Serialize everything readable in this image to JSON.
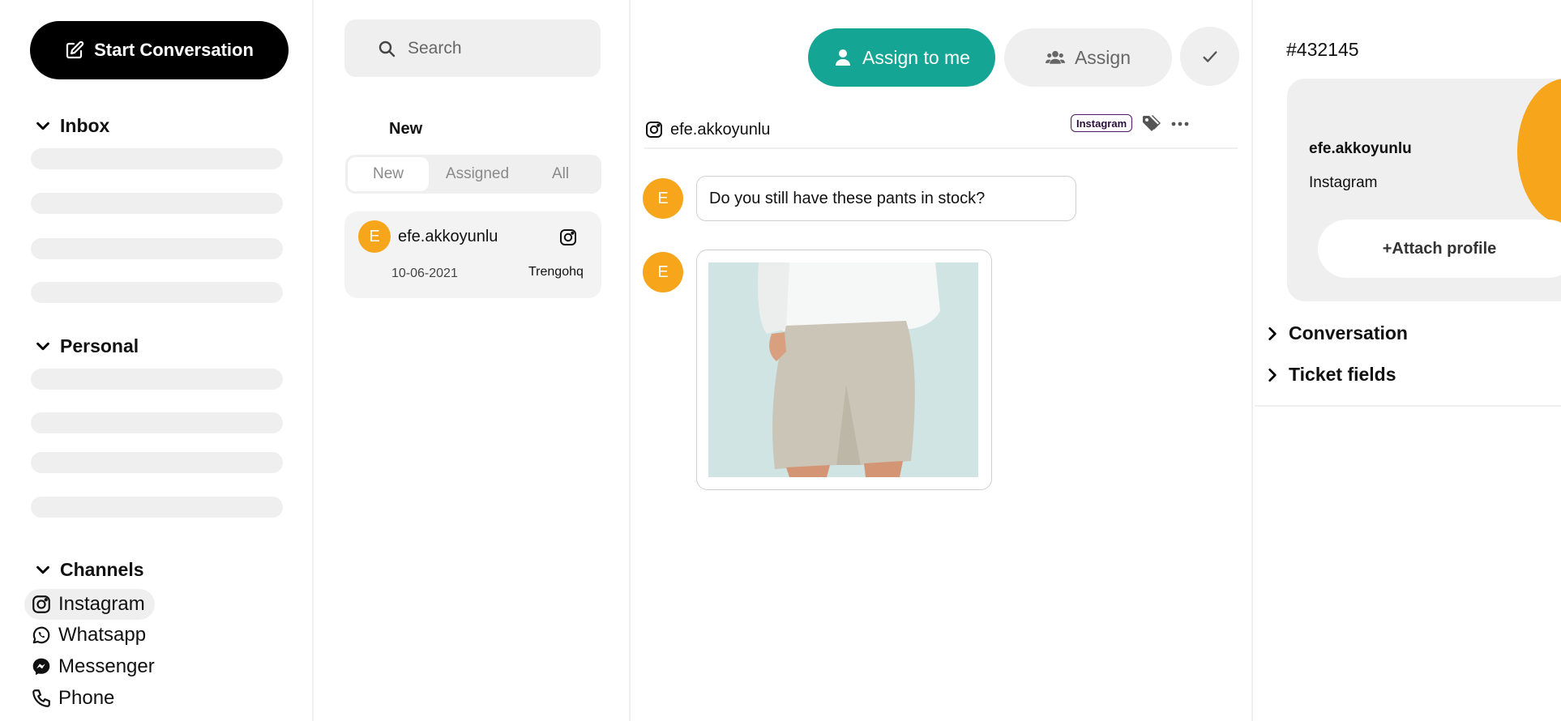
{
  "sidebar": {
    "start_label": "Start Conversation",
    "sections": {
      "inbox": "Inbox",
      "personal": "Personal",
      "channels": "Channels"
    },
    "channels": [
      {
        "label": "Instagram",
        "icon": "instagram-icon",
        "active": true
      },
      {
        "label": "Whatsapp",
        "icon": "whatsapp-icon",
        "active": false
      },
      {
        "label": "Messenger",
        "icon": "messenger-icon",
        "active": false
      },
      {
        "label": "Phone",
        "icon": "phone-icon",
        "active": false
      }
    ]
  },
  "list": {
    "search_placeholder": "Search",
    "title": "New",
    "tabs": [
      "New",
      "Assigned",
      "All"
    ],
    "active_tab": "New",
    "conversations": [
      {
        "initial": "E",
        "name": "efe.akkoyunlu",
        "date": "10-06-2021",
        "team": "Trengohq",
        "channel_icon": "instagram-icon"
      }
    ]
  },
  "chat": {
    "assign_me_label": "Assign to me",
    "assign_label": "Assign",
    "contact_name": "efe.akkoyunlu",
    "channel_badge": "Instagram",
    "messages": [
      {
        "initial": "E",
        "text": "Do you still have these pants in stock?"
      },
      {
        "initial": "E",
        "type": "image",
        "image": "photo of beige shorts"
      }
    ]
  },
  "detail": {
    "ticket_id": "#432145",
    "profile_name": "efe.akkoyunlu",
    "profile_channel": "Instagram",
    "attach_label": "+Attach profile",
    "sections": [
      "Conversation",
      "Ticket fields"
    ]
  },
  "colors": {
    "accent": "#14a594",
    "avatar": "#f7a51b",
    "surface": "#efefef"
  }
}
